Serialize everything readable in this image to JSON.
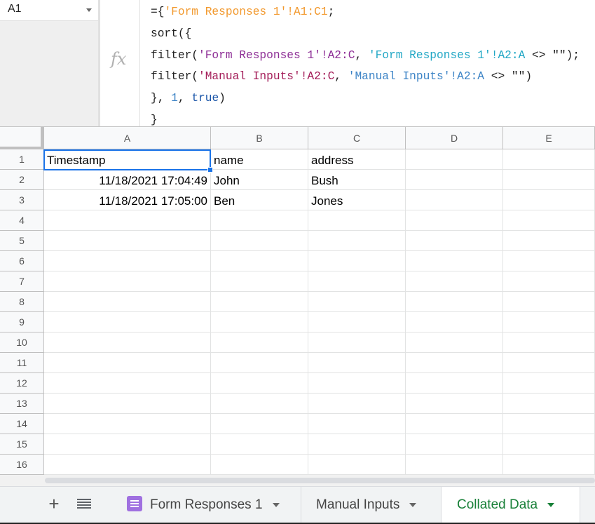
{
  "namebox": {
    "value": "A1"
  },
  "formula_bar": {
    "fx_label": "fx",
    "lines": [
      "={'Form Responses 1'!A1:C1;",
      "sort({",
      "filter('Form Responses 1'!A2:C, 'Form Responses 1'!A2:A <> \"\");",
      "filter('Manual Inputs'!A2:C, 'Manual Inputs'!A2:A <> \"\")",
      "}, 1, true)",
      "}"
    ]
  },
  "grid": {
    "columns": [
      "A",
      "B",
      "C",
      "D",
      "E"
    ],
    "row_numbers": [
      "1",
      "2",
      "3",
      "4",
      "5",
      "6",
      "7",
      "8",
      "9",
      "10",
      "11",
      "12",
      "13",
      "14",
      "15",
      "16"
    ],
    "rows": [
      [
        "Timestamp",
        "name",
        "address",
        "",
        ""
      ],
      [
        "11/18/2021 17:04:49",
        "John",
        "Bush",
        "",
        ""
      ],
      [
        "11/18/2021 17:05:00",
        "Ben",
        "Jones",
        "",
        ""
      ]
    ],
    "selected_cell": "A1"
  },
  "sheet_tabs": {
    "add_icon": "plus-icon",
    "list_icon": "menu-list-icon",
    "tabs": [
      {
        "label": "Form Responses 1",
        "icon": "form-icon",
        "active": false
      },
      {
        "label": "Manual Inputs",
        "icon": "",
        "active": false
      },
      {
        "label": "Collated Data",
        "icon": "",
        "active": true
      }
    ]
  },
  "colors": {
    "active_tab": "#188038",
    "selection": "#1a73e8",
    "ref_orange": "#f2992e",
    "ref_purple": "#8e2f96",
    "ref_teal": "#22a7c5",
    "ref_maroon": "#a31c58"
  }
}
